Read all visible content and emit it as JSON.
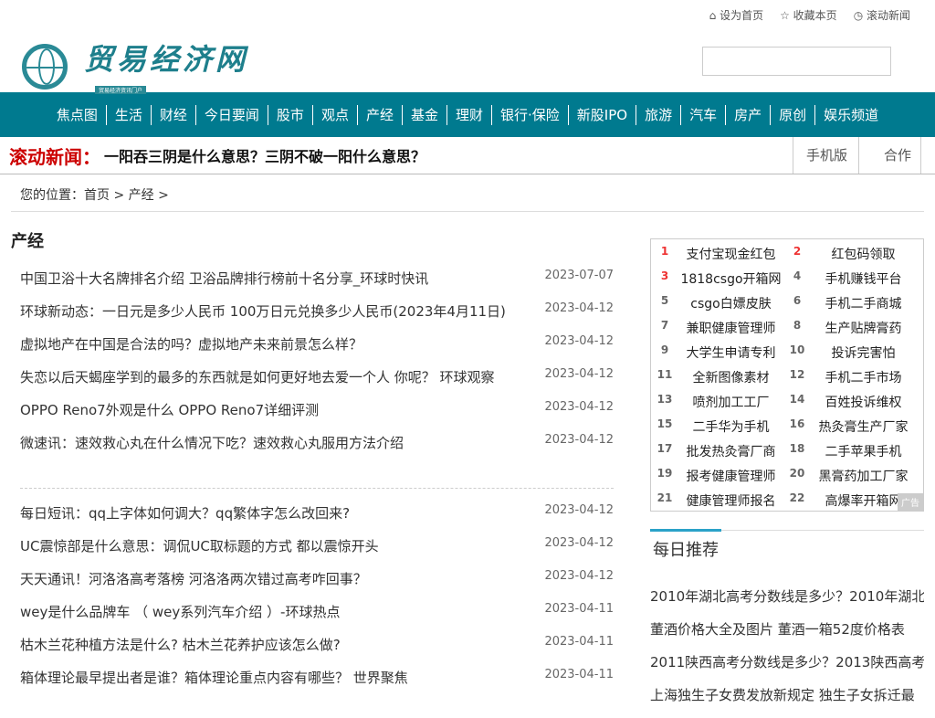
{
  "toplinks": [
    {
      "icon": "home-icon",
      "label": "设为首页"
    },
    {
      "icon": "star-icon",
      "label": "收藏本页"
    },
    {
      "icon": "clock-icon",
      "label": "滚动新闻"
    }
  ],
  "logo": {
    "title": "贸易经济网",
    "subtitle": "贸易经济资讯门户"
  },
  "nav": [
    "焦点图",
    "生活",
    "财经",
    "今日要闻",
    "股市",
    "观点",
    "产经",
    "基金",
    "理财",
    "银行·保险",
    "新股IPO",
    "旅游",
    "汽车",
    "房产",
    "原创",
    "娱乐频道"
  ],
  "ticker": {
    "label": "滚动新闻：",
    "text": "一阳吞三阴是什么意思？三阴不破一阳什么意思？",
    "links": [
      "手机版",
      "合作"
    ]
  },
  "breadcrumb": "您的位置：首页 > 产经 >",
  "section_title": "产经",
  "articles1": [
    {
      "title": "中国卫浴十大名牌排名介绍 卫浴品牌排行榜前十名分享_环球时快讯",
      "date": "2023-07-07"
    },
    {
      "title": "环球新动态：一日元是多少人民币 100万日元兑换多少人民币(2023年4月11日)",
      "date": "2023-04-12"
    },
    {
      "title": "虚拟地产在中国是合法的吗？虚拟地产未来前景怎么样？",
      "date": "2023-04-12"
    },
    {
      "title": "失恋以后天蝎座学到的最多的东西就是如何更好地去爱一个人 你呢？ 环球观察",
      "date": "2023-04-12"
    },
    {
      "title": "OPPO Reno7外观是什么 OPPO Reno7详细评测",
      "date": "2023-04-12"
    },
    {
      "title": "微速讯：速效救心丸在什么情况下吃？速效救心丸服用方法介绍",
      "date": "2023-04-12"
    }
  ],
  "articles2": [
    {
      "title": "每日短讯：qq上字体如何调大？qq繁体字怎么改回来?",
      "date": "2023-04-12"
    },
    {
      "title": "UC震惊部是什么意思：调侃UC取标题的方式 都以震惊开头",
      "date": "2023-04-12"
    },
    {
      "title": "天天通讯！河洛洛高考落榜 河洛洛两次错过高考咋回事？",
      "date": "2023-04-12"
    },
    {
      "title": "wey是什么品牌车 （ wey系列汽车介绍 ）-环球热点",
      "date": "2023-04-11"
    },
    {
      "title": "枯木兰花种植方法是什么? 枯木兰花养护应该怎么做?",
      "date": "2023-04-11"
    },
    {
      "title": "箱体理论最早提出者是谁？箱体理论重点内容有哪些？ 世界聚焦",
      "date": "2023-04-11"
    }
  ],
  "ads": [
    "支付宝现金红包",
    "红包码领取",
    "1818csgo开箱网",
    "手机赚钱平台",
    "csgo白嫖皮肤",
    "手机二手商城",
    "兼职健康管理师",
    "生产贴牌膏药",
    "大学生申请专利",
    "投诉完害怕",
    "全新图像素材",
    "手机二手市场",
    "喷剂加工工厂",
    "百姓投诉维权",
    "二手华为手机",
    "热灸膏生产厂家",
    "批发热灸膏厂商",
    "二手苹果手机",
    "报考健康管理师",
    "黑膏药加工厂家",
    "健康管理师报名",
    "高爆率开箱网"
  ],
  "ad_tag": "广告",
  "recommend": {
    "title": "每日推荐",
    "items": [
      "2010年湖北高考分数线是多少？2010年湖北",
      "董酒价格大全及图片 董酒一箱52度价格表",
      "2011陕西高考分数线是多少？2013陕西高考",
      "上海独生子女费发放新规定 独生子女拆迁最"
    ]
  },
  "colors": {
    "nav": "#007a8f",
    "ticker_label": "#cc0000",
    "rank_top": "#ee3333"
  }
}
